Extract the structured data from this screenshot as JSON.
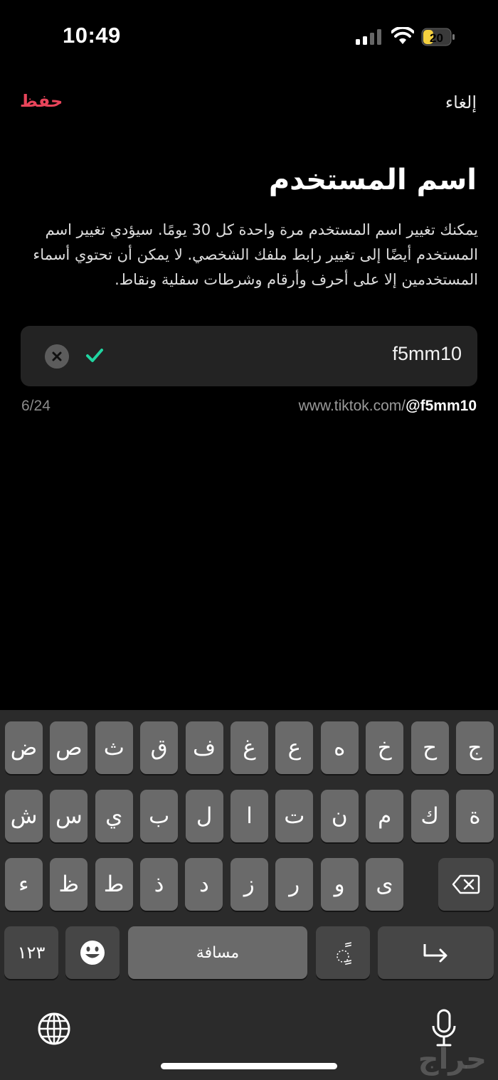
{
  "status": {
    "time": "10:49",
    "battery": "20",
    "battery_color": "#f4d03f"
  },
  "nav": {
    "cancel_label": "إلغاء",
    "save_label": "حفظ"
  },
  "page_title": "اسم المستخدم",
  "description": "يمكنك تغيير اسم المستخدم مرة واحدة كل 30 يومًا. سيؤدي تغيير اسم المستخدم أيضًا إلى تغيير رابط ملفك الشخصي. لا يمكن أن تحتوي أسماء المستخدمين إلا على أحرف وأرقام وشرطات سفلية ونقاط.",
  "input": {
    "value": "f5mm10",
    "valid_color": "#20d5a1"
  },
  "url": {
    "base": "www.tiktok.com/",
    "handle": "@f5mm10"
  },
  "char_count": "6/24",
  "keyboard": {
    "row1": [
      "ج",
      "ح",
      "خ",
      "ه",
      "ع",
      "غ",
      "ف",
      "ق",
      "ث",
      "ص",
      "ض"
    ],
    "row2": [
      "ة",
      "ك",
      "م",
      "ن",
      "ت",
      "ا",
      "ل",
      "ب",
      "ي",
      "س",
      "ش"
    ],
    "row3": [
      "ى",
      "و",
      "ر",
      "ز",
      "د",
      "ذ",
      "ط",
      "ظ",
      "ء"
    ],
    "numbers_label": "١٢٣",
    "space_label": "مسافة",
    "diacritic_label": "ًٍ"
  },
  "watermark": "حراج"
}
